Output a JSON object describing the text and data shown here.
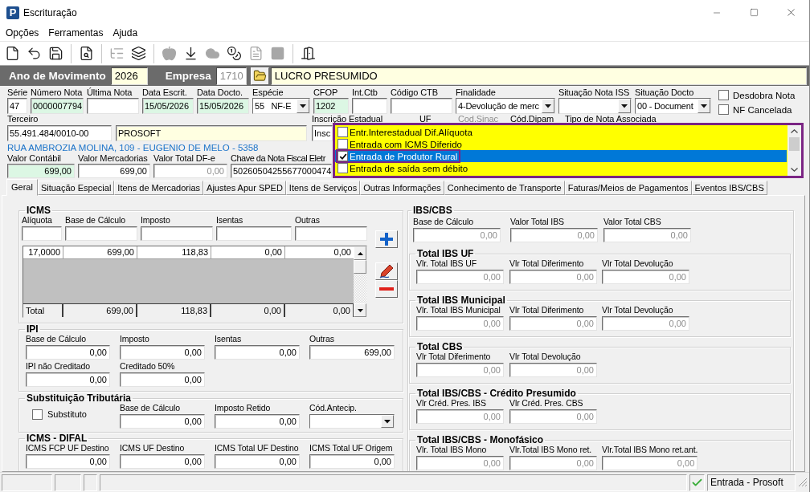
{
  "window": {
    "logo": "P",
    "title": "Escrituração"
  },
  "menu": [
    {
      "label": "Opções"
    },
    {
      "label": "Ferramentas"
    },
    {
      "label": "Ajuda"
    }
  ],
  "toolbar": [
    [
      {
        "disabled": false
      },
      {
        "disabled": false
      },
      {
        "disabled": false
      }
    ],
    [
      {
        "disabled": false
      }
    ],
    [
      {
        "disabled": true
      },
      {
        "disabled": false
      }
    ],
    [
      {
        "disabled": true
      },
      {
        "disabled": false
      },
      {
        "disabled": true
      },
      {
        "disabled": false
      },
      {
        "disabled": true
      },
      {
        "disabled": true
      }
    ],
    [
      {
        "disabled": false
      }
    ]
  ],
  "header": {
    "year_label": "Ano de Movimento",
    "year": "2026",
    "company_label": "Empresa",
    "company_code": "1710",
    "company_code_disabled": true,
    "company_name": "LUCRO PRESUMIDO"
  },
  "note": {
    "fields": [
      {
        "kind": "text",
        "label": "Série",
        "value": "47"
      },
      {
        "kind": "text",
        "label": "Número Nota",
        "value": "0000007794",
        "color": "#dcf7e4"
      },
      {
        "kind": "text",
        "label": "Última Nota"
      },
      {
        "kind": "text",
        "label": "Data Escrit.",
        "value": "15/05/2026",
        "color": "#dcf7e4"
      },
      {
        "kind": "text",
        "label": "Data Docto.",
        "value": "15/05/2026",
        "color": "#dcf7e4"
      },
      {
        "kind": "select",
        "label": "Espécie",
        "value": "55   NF-E"
      },
      {
        "kind": "text",
        "label": "CFOP",
        "value": "1202",
        "color": "#dcf7e4"
      },
      {
        "kind": "text",
        "label": "Int.Ctb"
      },
      {
        "kind": "text",
        "label": "Código CTB"
      },
      {
        "kind": "select",
        "label": "Finalidade",
        "value": "4-Devolução de merc"
      },
      {
        "kind": "select",
        "label": "Situação Nota ISS"
      },
      {
        "kind": "select",
        "label": "Situação Docto",
        "value": "00 - Document"
      }
    ],
    "checkboxes": [
      {
        "label": "Desdobra Nota",
        "checked": false
      },
      {
        "label": "NF Cancelada",
        "checked": false
      }
    ],
    "third_party": {
      "label": "Terceiro",
      "fields": [
        {
          "value": "55.491.484/0010-00"
        },
        {
          "value": "PROSOFT",
          "color": "#ffffe1"
        }
      ]
    },
    "state_registration": {
      "label": "Inscrição Estadual",
      "value": "Insc"
    },
    "more_labels": [
      {
        "label": "UF",
        "disabled": false
      },
      {
        "label": "Cod.Sinac",
        "disabled": true
      },
      {
        "label": "Cód.Dipam",
        "disabled": false
      },
      {
        "label": "Tipo de Nota Associada",
        "disabled": false
      }
    ],
    "address": "RUA AMBROZIA MOLINA, 109 - EUGENIO DE MELO - 5358",
    "values": [
      {
        "kind": "number",
        "label": "Valor Contábil",
        "value": "699,00",
        "color": "#dcf7e4",
        "disabled": false
      },
      {
        "kind": "number",
        "label": "Valor Mercadorias",
        "value": "699,00",
        "disabled": false
      },
      {
        "kind": "number",
        "label": "Valor Total DF-e",
        "value": "0,00",
        "disabled": true
      },
      {
        "kind": "text",
        "label": "Chave da Nota Fiscal Eletr",
        "value": "50260504255677000474",
        "disabled": false
      }
    ]
  },
  "type_list": {
    "items": [
      {
        "label": "Entr.Interestadual Dif.Alíquota",
        "checked": false,
        "selected": false
      },
      {
        "label": "Entrada com ICMS Diferido",
        "checked": false,
        "selected": false
      },
      {
        "label": "Entrada de Produtor Rural",
        "checked": true,
        "selected": true
      },
      {
        "label": "Entrada de saída sem débito",
        "checked": false,
        "selected": false
      }
    ]
  },
  "tabs": [
    {
      "label": "Geral",
      "selected": true
    },
    {
      "label": "Situação Especial",
      "selected": false
    },
    {
      "label": "Itens de Mercadorias",
      "selected": false
    },
    {
      "label": "Ajustes Apur SPED",
      "selected": false
    },
    {
      "label": "Itens de Serviços",
      "selected": false
    },
    {
      "label": "Outras Informações",
      "selected": false
    },
    {
      "label": "Conhecimento de Transporte",
      "selected": false
    },
    {
      "label": "Faturas/Meios de Pagamentos",
      "selected": false
    },
    {
      "label": "Eventos IBS/CBS",
      "selected": false
    }
  ],
  "icms": {
    "title": "ICMS",
    "columns": [
      "Alíquota",
      "Base de Cálculo",
      "Imposto",
      "Isentas",
      "Outras"
    ],
    "rows": [
      [
        "17,0000",
        "699,00",
        "118,83",
        "0,00",
        "0,00"
      ]
    ],
    "total": [
      "Total",
      "699,00",
      "118,83",
      "0,00",
      "0,00"
    ]
  },
  "ipi": {
    "title": "IPI",
    "fields": [
      {
        "label": "Base de Cálculo",
        "value": "0,00"
      },
      {
        "label": "Imposto",
        "value": "0,00"
      },
      {
        "label": "Isentas",
        "value": "0,00"
      },
      {
        "label": "Outras",
        "value": "699,00"
      },
      {
        "label": "IPI não Creditado",
        "value": "0,00"
      },
      {
        "label": "Creditado 50%",
        "value": "0,00"
      }
    ]
  },
  "substitution": {
    "title": "Substituição Tributária",
    "checkbox": {
      "label": "Substituto",
      "checked": false
    },
    "fields": [
      {
        "kind": "number",
        "label": "Base de Cálculo",
        "value": "0,00"
      },
      {
        "kind": "number",
        "label": "Imposto Retido",
        "value": "0,00"
      },
      {
        "kind": "select",
        "label": "Cód.Antecip."
      }
    ]
  },
  "difal": {
    "title": "ICMS - DIFAL",
    "fields": [
      {
        "label": "ICMS FCP UF Destino",
        "value": "0,00"
      },
      {
        "label": "ICMS UF Destino",
        "value": "0,00"
      },
      {
        "label": "ICMS Total UF Destino",
        "value": "0,00"
      },
      {
        "label": "ICMS Total UF Origem",
        "value": "0,00"
      }
    ]
  },
  "ibs_cbs": {
    "title": "IBS/CBS",
    "disabled": true,
    "fields": [
      {
        "label": "Base de Cálculo",
        "value": "0,00"
      },
      {
        "label": "Valor Total IBS",
        "value": "0,00"
      },
      {
        "label": "Valor Total CBS",
        "value": "0,00"
      }
    ],
    "groups": [
      {
        "title": "Total IBS UF",
        "fields": [
          {
            "label": "Vlr. Total IBS UF",
            "value": "0,00"
          },
          {
            "label": "Vlr Total Diferimento",
            "value": "0,00"
          },
          {
            "label": "Vlr Total Devolução",
            "value": "0,00"
          }
        ]
      },
      {
        "title": "Total IBS Municipal",
        "fields": [
          {
            "label": "Vlr. Total IBS Municipal",
            "value": "0,00"
          },
          {
            "label": "Vlr Total Diferimento",
            "value": "0,00"
          },
          {
            "label": "Vlr Total Devolução",
            "value": "0,00"
          }
        ]
      },
      {
        "title": "Total CBS",
        "fields": [
          {
            "label": "Vlr Total Diferimento",
            "value": "0,00"
          },
          {
            "label": "Vlr Total Devolução",
            "value": "0,00"
          }
        ]
      },
      {
        "title": "Total IBS/CBS - Crédito Presumido",
        "fields": [
          {
            "label": "Vlr Créd. Pres. IBS",
            "value": "0,00"
          },
          {
            "label": "Vlr Créd. Pres. CBS",
            "value": "0,00"
          }
        ]
      },
      {
        "title": "Total IBS/CBS - Monofásico",
        "fields": [
          {
            "label": "Vlr. Total IBS Mono",
            "value": "0,00"
          },
          {
            "label": "Vlr.Total IBS Mono ret.",
            "value": "0,00"
          },
          {
            "label": "Vlr.Total IBS Mono ret.ant.",
            "value": "0,00"
          }
        ]
      }
    ]
  },
  "status_bar": {
    "message": "Entrada - Prosoft"
  }
}
